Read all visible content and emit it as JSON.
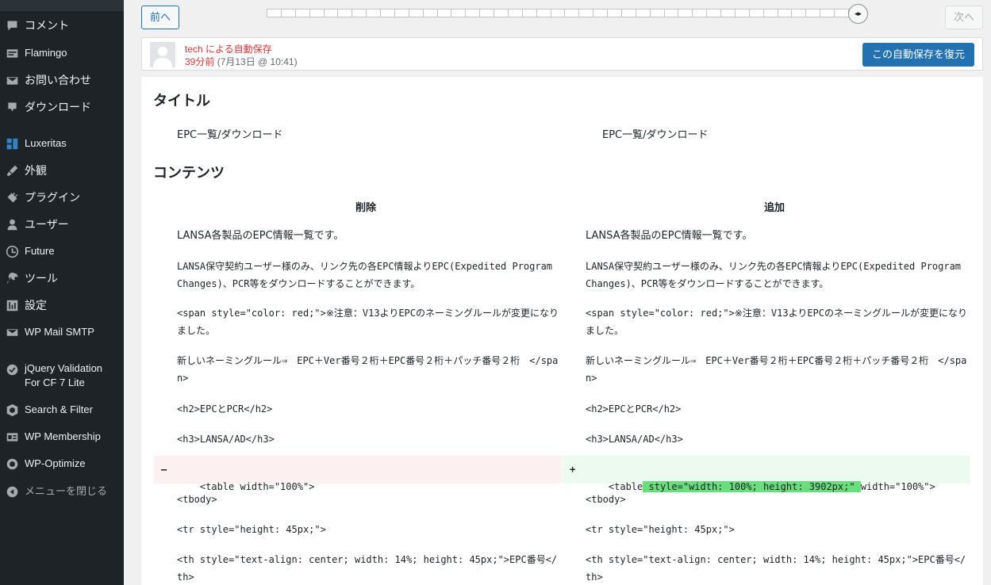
{
  "sidebar": {
    "items": [
      {
        "label": "コメント",
        "icon": "comment-icon"
      },
      {
        "label": "Flamingo",
        "icon": "flamingo-icon"
      },
      {
        "label": "お問い合わせ",
        "icon": "mail-icon"
      },
      {
        "label": "ダウンロード",
        "icon": "download-icon"
      },
      {
        "label": "Luxeritas",
        "icon": "luxeritas-icon"
      },
      {
        "label": "外観",
        "icon": "appearance-icon"
      },
      {
        "label": "プラグイン",
        "icon": "plugin-icon"
      },
      {
        "label": "ユーザー",
        "icon": "user-icon"
      },
      {
        "label": "Future",
        "icon": "clock-icon"
      },
      {
        "label": "ツール",
        "icon": "wrench-icon"
      },
      {
        "label": "設定",
        "icon": "settings-icon"
      },
      {
        "label": "WP Mail SMTP",
        "icon": "mail-smtp-icon"
      },
      {
        "label": "jQuery Validation For CF 7 Lite",
        "icon": "check-circle-icon"
      },
      {
        "label": "Search & Filter",
        "icon": "search-filter-icon"
      },
      {
        "label": "WP Membership",
        "icon": "membership-icon"
      },
      {
        "label": "WP-Optimize",
        "icon": "optimize-icon"
      },
      {
        "label": "メニューを閉じる",
        "icon": "collapse-icon"
      }
    ]
  },
  "nav": {
    "prev_label": "前へ",
    "next_label": "次へ"
  },
  "meta": {
    "author": "tech による自動保存",
    "time_ago": "39分前",
    "time_date": " (7月13日 @ 10:41)",
    "restore_label": "この自動保存を復元"
  },
  "diff": {
    "title_heading": "タイトル",
    "title_left": "EPC一覧/ダウンロード",
    "title_right": "EPC一覧/ダウンロード",
    "content_heading": "コンテンツ",
    "col_removed": "削除",
    "col_added": "追加",
    "lines": [
      "LANSA各製品のEPC情報一覧です。",
      "LANSA保守契約ユーザー様のみ、リンク先の各EPC情報よりEPC(Expedited Program Changes)、PCR等をダウンロードすることができます。",
      "<span style=\"color: red;\">※注意：V13よりEPCのネーミングルールが変更になりました。",
      "新しいネーミングルール⇒　EPC＋Ver番号２桁＋EPC番号２桁＋パッチ番号２桁　</span>",
      "<h2>EPCとPCR</h2>",
      "<h3>LANSA/AD</h3>",
      "<tbody>",
      "<tr style=\"height: 45px;\">",
      "<th style=\"text-align: center; width: 14%; height: 45px;\">EPC番号</th>"
    ],
    "changed_left": "<table width=\"100%\">",
    "changed_right_before": "<table",
    "changed_right_added": " style=\"width: 100%; height: 3902px;\" ",
    "changed_right_after": "width=\"100%\">",
    "del_mark": "–",
    "add_mark": "+"
  }
}
